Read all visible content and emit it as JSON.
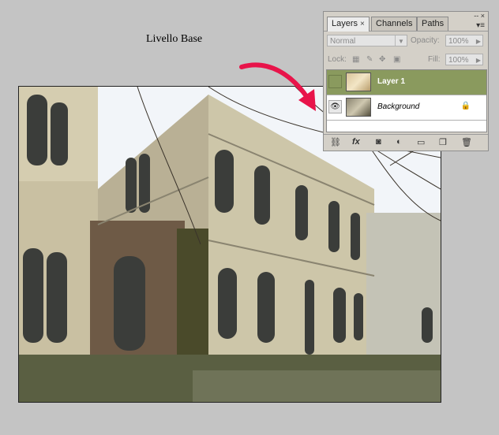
{
  "caption": "Livello Base",
  "panel": {
    "tabs": [
      {
        "label": "Layers",
        "close": "×"
      },
      {
        "label": "Channels"
      },
      {
        "label": "Paths"
      }
    ],
    "window_controls": "-- ×",
    "menu_glyph": "▾≡",
    "blend_mode": "Normal",
    "opacity_label": "Opacity:",
    "opacity_value": "100%",
    "lock_label": "Lock:",
    "fill_label": "Fill:",
    "fill_value": "100%",
    "layers": [
      {
        "name": "Layer 1",
        "selected": true
      },
      {
        "name": "Background",
        "selected": false
      }
    ],
    "footer_icons": [
      "link-icon",
      "fx-icon",
      "mask-icon",
      "adjustment-icon",
      "folder-icon",
      "new-layer-icon",
      "trash-icon"
    ],
    "fx_label": "fx"
  },
  "colors": {
    "selected_layer": "#8a9a5e",
    "arrow": "#e8144a"
  }
}
